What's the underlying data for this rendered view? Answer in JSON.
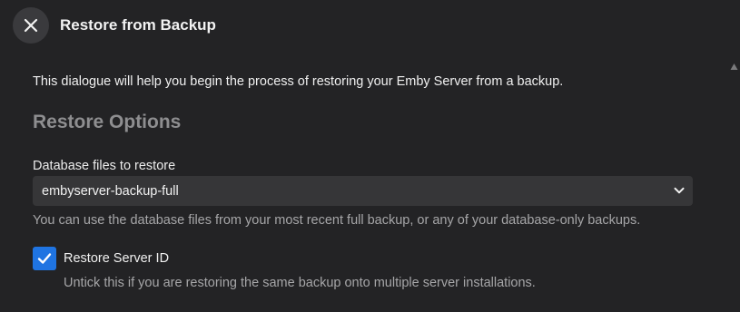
{
  "dialog": {
    "title": "Restore from Backup",
    "intro": "This dialogue will help you begin the process of restoring your Emby Server from a backup."
  },
  "restore_options": {
    "heading": "Restore Options",
    "database_field": {
      "label": "Database files to restore",
      "selected_value": "embyserver-backup-full",
      "help": "You can use the database files from your most recent full backup, or any of your database-only backups."
    },
    "server_id": {
      "label": "Restore Server ID",
      "checked": true,
      "help": "Untick this if you are restoring the same backup onto multiple server installations."
    }
  },
  "colors": {
    "background": "#232325",
    "accent": "#1f74e2",
    "muted_text": "#a6a6a8",
    "heading": "#8e8e90"
  },
  "icons": {
    "close": "close-icon",
    "select": "chevron-down-icon",
    "checkbox": "checkmark-icon",
    "scroll": "scroll-up-arrow-icon"
  }
}
